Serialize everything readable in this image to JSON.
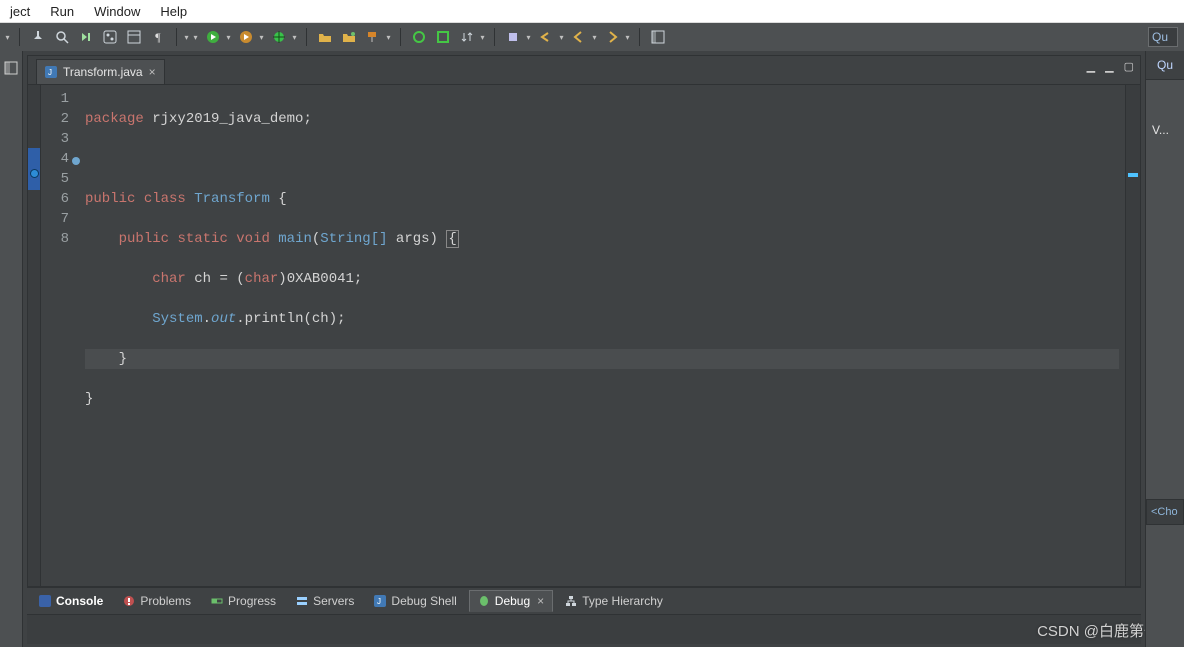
{
  "menu": {
    "items": [
      "ject",
      "Run",
      "Window",
      "Help"
    ]
  },
  "toolbar": {
    "quick_search_placeholder": "Qu"
  },
  "editor": {
    "tab_title": "Transform.java",
    "line_numbers": [
      "1",
      "2",
      "3",
      "4",
      "5",
      "6",
      "7",
      "8"
    ],
    "main_marker_line": 4,
    "current_line": 7,
    "code": {
      "package_kw": "package",
      "package_name": "rjxy2019_java_demo",
      "public_kw": "public",
      "class_kw": "class",
      "class_name": "Transform",
      "static_kw": "static",
      "void_kw": "void",
      "main_name": "main",
      "string_arr": "String[]",
      "args_name": "args",
      "char_kw": "char",
      "var_ch": "ch",
      "eq": "=",
      "cast_open": "(",
      "cast_type": "char",
      "cast_close": ")",
      "hex_literal": "0XAB0041",
      "system": "System",
      "out": "out",
      "println": "println",
      "arg_ch": "ch"
    }
  },
  "bottom_tabs": {
    "console": "Console",
    "problems": "Problems",
    "progress": "Progress",
    "servers": "Servers",
    "debug_shell": "Debug Shell",
    "debug": "Debug",
    "type_hierarchy": "Type Hierarchy"
  },
  "right": {
    "top_search": "Qu",
    "vlabel": "V...",
    "outline": "<Cho"
  },
  "watermark": "CSDN @白鹿第一帅"
}
